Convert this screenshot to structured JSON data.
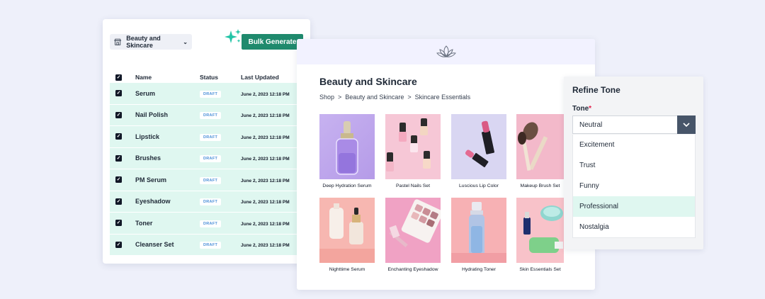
{
  "list_panel": {
    "category": "Beauty and Skincare",
    "bulk_button": "Bulk Generate",
    "columns": {
      "name": "Name",
      "status": "Status",
      "updated": "Last Updated"
    },
    "rows": [
      {
        "name": "Serum",
        "status": "DRAFT",
        "updated": "June 2, 2023  12:18 PM"
      },
      {
        "name": "Nail Polish",
        "status": "DRAFT",
        "updated": "June 2, 2023  12:18 PM"
      },
      {
        "name": "Lipstick",
        "status": "DRAFT",
        "updated": "June 2, 2023  12:18 PM"
      },
      {
        "name": "Brushes",
        "status": "DRAFT",
        "updated": "June 2, 2023  12:18 PM"
      },
      {
        "name": "PM Serum",
        "status": "DRAFT",
        "updated": "June 2, 2023  12:18 PM"
      },
      {
        "name": "Eyeshadow",
        "status": "DRAFT",
        "updated": "June 2, 2023  12:18 PM"
      },
      {
        "name": "Toner",
        "status": "DRAFT",
        "updated": "June 2, 2023  12:18 PM"
      },
      {
        "name": "Cleanser Set",
        "status": "DRAFT",
        "updated": "June 2, 2023  12:18 PM"
      }
    ]
  },
  "storefront": {
    "title": "Beauty and Skincare",
    "breadcrumb": [
      "Shop",
      ">",
      "Beauty and Skincare",
      ">",
      "Skincare Essentials"
    ],
    "products": [
      "Deep Hydration Serum",
      "Pastel Nails Set",
      "Luscious Lip Color",
      "Makeup Brush Set",
      "Nighttime Serum",
      "Enchanting Eyeshadow",
      "Hydrating Toner",
      "Skin Essentials Set"
    ]
  },
  "tone_panel": {
    "title": "Refine Tone",
    "label": "Tone",
    "required_mark": "*",
    "selected": "Neutral",
    "options": [
      "Excitement",
      "Trust",
      "Funny",
      "Professional",
      "Nostalgia"
    ],
    "highlighted": "Professional"
  },
  "colors": {
    "accent_green": "#1f8a6d",
    "row_mint": "#dff7f0",
    "background": "#eef0fa",
    "dropdown_arrow_bg": "#475569"
  },
  "icons": {
    "store": "store-icon",
    "sparkle": "sparkle-icon",
    "lotus": "lotus-logo-icon",
    "chevron": "chevron-down-icon"
  }
}
